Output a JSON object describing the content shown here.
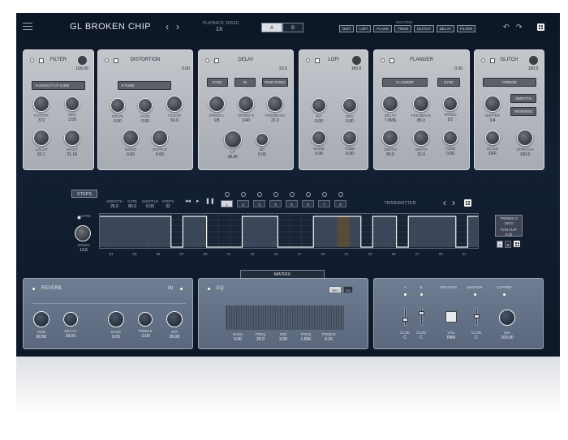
{
  "app": {
    "title": "GL BROKEN CHIP",
    "playback_label": "PLAYBACK SPEED",
    "playback_value": "1X",
    "a": "A",
    "b": "B",
    "routing_label": "ROUTING",
    "routing": [
      "DIST",
      "LOFI",
      "FLANG",
      "TREM",
      "GLITCH",
      "DELAY",
      "FILTER"
    ]
  },
  "filter": {
    "title": "FILTER",
    "value": "100.00",
    "preset": "LEGACY LP 12DB",
    "k": [
      {
        "l": "CUTOFF",
        "v": "372"
      },
      {
        "l": "RES",
        "v": "2.05"
      },
      {
        "l": "LOCUT",
        "v": "62.1"
      },
      {
        "l": "HICUT",
        "v": "21.1K"
      }
    ]
  },
  "distortion": {
    "title": "DISTORTION",
    "value": "0.00",
    "preset": "TUBE",
    "k": [
      {
        "l": "DRIVE",
        "v": "0.00"
      },
      {
        "l": "FUZZ",
        "v": "0.00"
      },
      {
        "l": "COLOR",
        "v": "50.0"
      },
      {
        "l": "MONO",
        "v": "0.00"
      },
      {
        "l": "OUTPUT",
        "v": "0.00"
      }
    ]
  },
  "delay": {
    "title": "DELAY",
    "value": "23.5",
    "btns": [
      "SYNC",
      "IN",
      "PING-PONG"
    ],
    "k": [
      {
        "l": "SPEED L",
        "v": "1/8"
      },
      {
        "l": "SPEED R",
        "v": "1/40"
      },
      {
        "l": "FEEDBACK",
        "v": "21.0"
      },
      {
        "l": "LP",
        "v": "18.0K"
      },
      {
        "l": "BP",
        "v": "0.00"
      }
    ]
  },
  "lofi": {
    "title": "LOFI",
    "value": "100.0",
    "k": [
      {
        "l": "BIT",
        "v": "0.00"
      },
      {
        "l": "SRC",
        "v": "0.00"
      },
      {
        "l": "NOISE",
        "v": "0.00"
      },
      {
        "l": "TONE",
        "v": "0.00"
      }
    ]
  },
  "flanger": {
    "title": "FLANGER",
    "value": "0.00",
    "btns": [
      "FLANGER",
      "SYNC"
    ],
    "k": [
      {
        "l": "DELAY",
        "v": "7.0MS"
      },
      {
        "l": "FEEDBACK",
        "v": "85.0"
      },
      {
        "l": "SPEED",
        "v": "2/1"
      },
      {
        "l": "DEPTH",
        "v": "80.0"
      },
      {
        "l": "WIDTH",
        "v": "15.0"
      },
      {
        "l": "TONE",
        "v": "0.00"
      }
    ]
  },
  "glitch": {
    "title": "GLITCH",
    "value": "100.0",
    "btns": [
      "FREEZE",
      "SMOOTH",
      "REVERSE"
    ],
    "k": [
      {
        "l": "BUFFER",
        "v": "1/4"
      },
      {
        "l": "SCALE",
        "v": "OFF"
      },
      {
        "l": "STRETCH",
        "v": "100.0"
      }
    ]
  },
  "seq": {
    "steps": "STEPS",
    "heads": [
      {
        "l": "SMOOTH",
        "v": "25.0"
      },
      {
        "l": "GATE",
        "v": "80.0"
      },
      {
        "l": "SHUFFLE",
        "v": "0.00"
      },
      {
        "l": "STEPS",
        "v": "32"
      }
    ],
    "pages": [
      "1",
      "2",
      "3",
      "4",
      "5",
      "6",
      "7",
      "8"
    ],
    "transmitter": "TRANSMITTER",
    "sync": "SYNC",
    "speed_l": "SPEED",
    "speed_v": "1/16",
    "xlabels": [
      "01",
      "03",
      "05",
      "07",
      "09",
      "11",
      "13",
      "15",
      "17",
      "19",
      "21",
      "23",
      "25",
      "27",
      "29",
      "31"
    ],
    "tremolo_l": "TREMOLO",
    "tremolo_v": "100.0",
    "panflip_l": "PAN FLIP",
    "panflip_v": "0.00",
    "ab": [
      "A",
      "B"
    ]
  },
  "matrix": "MATRIX",
  "reverb": {
    "title": "REVERB",
    "in": "IN",
    "k": [
      {
        "l": "SIZE",
        "v": "60.50"
      },
      {
        "l": "DECAY",
        "v": "39.00"
      },
      {
        "l": "BASS",
        "v": "0.00"
      },
      {
        "l": "TREBLE",
        "v": "-3.00"
      },
      {
        "l": "MIX",
        "v": "26.00"
      }
    ]
  },
  "eq": {
    "title": "EQ",
    "rev": "REV",
    "eq": "EQ",
    "k": [
      {
        "l": "BASS",
        "v": "0.00"
      },
      {
        "l": "FREQ",
        "v": "20.0"
      },
      {
        "l": "MID",
        "v": "3.00"
      },
      {
        "l": "FREQ",
        "v": "1.65K"
      },
      {
        "l": "TREBLE",
        "v": "4.16"
      }
    ]
  },
  "master": {
    "a": "A",
    "b": "B",
    "routing": "ROUTING",
    "master": "MASTER",
    "clipper": "CLIPPER",
    "k": [
      {
        "l": "CLOD",
        "v": "C"
      },
      {
        "l": "CLOD",
        "v": "C"
      },
      {
        "l": "VOL",
        "v": "PAN"
      },
      {
        "l": "CLOD",
        "v": "C"
      },
      {
        "l": "MIX",
        "v": "100.00"
      }
    ]
  },
  "seq_pattern": [
    1,
    1,
    1,
    1,
    1,
    1,
    0,
    1,
    1,
    0,
    0,
    0,
    1,
    1,
    1,
    0,
    0,
    0,
    1,
    1,
    1,
    1,
    0,
    1,
    1,
    0,
    1,
    1,
    1,
    1,
    0,
    1
  ]
}
